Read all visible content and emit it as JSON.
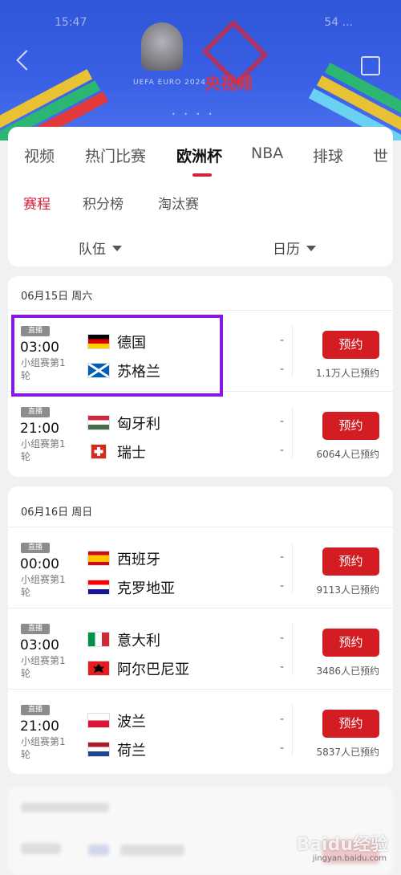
{
  "status_bar": {
    "time": "15:47",
    "right": "54 ..."
  },
  "hero": {
    "logo_text": "UEFA EURO 2024",
    "brand": "央视频",
    "dots": "• • • •"
  },
  "tabs": [
    {
      "label": "视频"
    },
    {
      "label": "热门比赛"
    },
    {
      "label": "欧洲杯"
    },
    {
      "label": "NBA"
    },
    {
      "label": "排球"
    },
    {
      "label": "世"
    }
  ],
  "subtabs": [
    {
      "label": "赛程"
    },
    {
      "label": "积分榜"
    },
    {
      "label": "淘汰赛"
    }
  ],
  "filters": {
    "team": "队伍",
    "calendar": "日历"
  },
  "days": [
    {
      "title": "06月15日 周六",
      "matches": [
        {
          "badge": "直播",
          "time": "03:00",
          "round": "小组赛第1轮",
          "home": "德国",
          "away": "苏格兰",
          "home_score": "-",
          "away_score": "-",
          "button": "预约",
          "count": "1.1万人已预约"
        },
        {
          "badge": "直播",
          "time": "21:00",
          "round": "小组赛第1轮",
          "home": "匈牙利",
          "away": "瑞士",
          "home_score": "-",
          "away_score": "-",
          "button": "预约",
          "count": "6064人已预约"
        }
      ]
    },
    {
      "title": "06月16日 周日",
      "matches": [
        {
          "badge": "直播",
          "time": "00:00",
          "round": "小组赛第1轮",
          "home": "西班牙",
          "away": "克罗地亚",
          "home_score": "-",
          "away_score": "-",
          "button": "预约",
          "count": "9113人已预约"
        },
        {
          "badge": "直播",
          "time": "03:00",
          "round": "小组赛第1轮",
          "home": "意大利",
          "away": "阿尔巴尼亚",
          "home_score": "-",
          "away_score": "-",
          "button": "预约",
          "count": "3486人已预约"
        },
        {
          "badge": "直播",
          "time": "21:00",
          "round": "小组赛第1轮",
          "home": "波兰",
          "away": "荷兰",
          "home_score": "-",
          "away_score": "-",
          "button": "预约",
          "count": "5837人已预约"
        }
      ]
    }
  ],
  "watermark": {
    "main": "Baidu经验",
    "sub": "jingyan.baidu.com"
  },
  "colors": {
    "accent": "#d4213a",
    "button": "#d41c23",
    "highlight": "#8a16e6",
    "hero": "#3a60e6"
  }
}
